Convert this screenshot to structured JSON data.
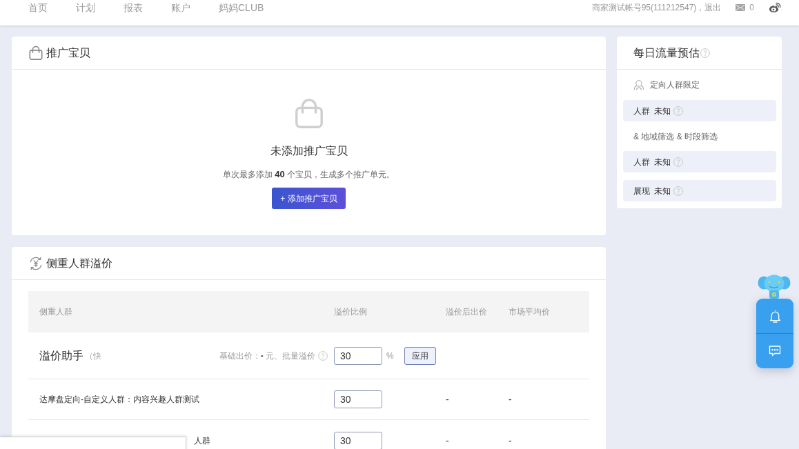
{
  "nav": {
    "items": [
      "首页",
      "计划",
      "报表",
      "账户",
      "妈妈CLUB"
    ]
  },
  "account": {
    "text": "商家测试帐号95(111212547)，",
    "logout": "退出",
    "message_count": "0"
  },
  "promo_card": {
    "title": "推广宝贝",
    "empty_title": "未添加推广宝贝",
    "empty_hint": "单次最多添加 **40** 个宝贝，生成多个推广单元。",
    "add_button": "+ 添加推广宝贝"
  },
  "premium_card": {
    "title": "侧重人群溢价",
    "table": {
      "columns": [
        "侧重人群",
        "溢价比例",
        "溢价后出价",
        "市场平均价"
      ],
      "assistant": {
        "title": "溢价助手",
        "note": "（快",
        "info": "基础出价：**-** 元、批量溢价",
        "value": "30",
        "unit": "%",
        "apply_button": "应用"
      },
      "rows": [
        {
          "label": "达摩盘定向-自定义人群：内容兴趣人群测试",
          "covered": false,
          "ratio": "30",
          "after_price": "-",
          "market_avg": "-"
        },
        {
          "label": "人群",
          "covered": true,
          "ratio": "30",
          "after_price": "-",
          "market_avg": "-"
        }
      ]
    }
  },
  "traffic_card": {
    "title": "每日流量预估",
    "items": [
      {
        "kind": "heading",
        "text": "定向人群限定"
      },
      {
        "kind": "stat",
        "label": "人群",
        "value": "未知"
      },
      {
        "kind": "note",
        "text": "& 地域筛选 & 时段筛选"
      },
      {
        "kind": "stat",
        "label": "人群",
        "value": "未知"
      },
      {
        "kind": "stat",
        "label": "展现",
        "value": "未知"
      }
    ]
  }
}
